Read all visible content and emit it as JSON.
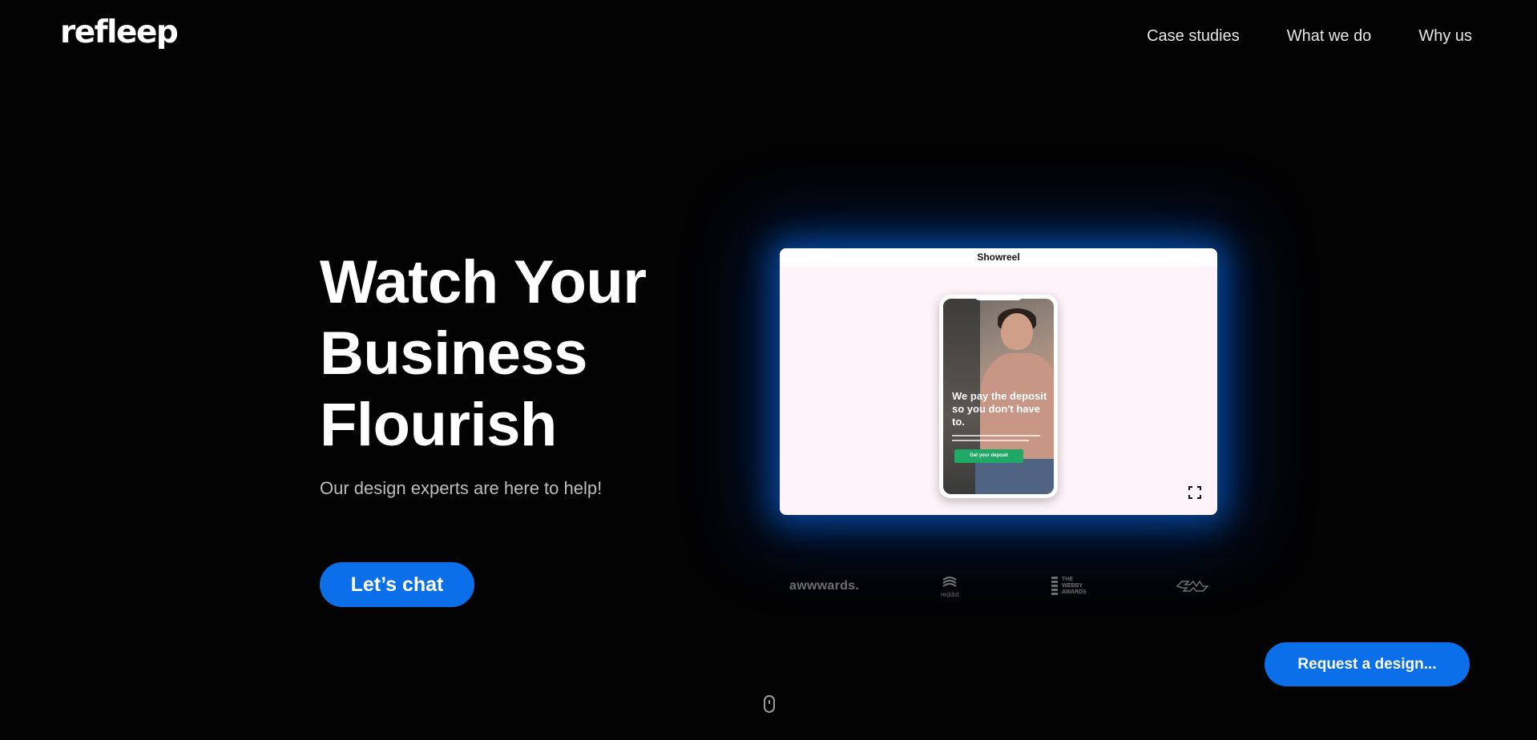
{
  "header": {
    "logo": "refleep",
    "nav": [
      {
        "label": "Case studies"
      },
      {
        "label": "What we do"
      },
      {
        "label": "Why us"
      }
    ]
  },
  "hero": {
    "title_lines": [
      "Watch Your",
      "Business",
      "Flourish"
    ],
    "subtitle": "Our design experts are here to help!",
    "cta_label": "Let’s chat"
  },
  "showreel": {
    "title": "Showreel",
    "phone_headline": "We pay the deposit so you don't have to.",
    "phone_cta": "Get your deposit",
    "fullscreen_icon": "fullscreen-icon"
  },
  "awards": {
    "awwwards": "awwwards.",
    "reddot": "reddot",
    "webby_line1": "THE",
    "webby_line2": "WEBBY",
    "webby_line3": "AWARDS",
    "fwa_icon": "fwa-logo-icon"
  },
  "request_button": "Request a design...",
  "scroll_icon": "mouse-scroll-icon",
  "colors": {
    "background": "#030304",
    "accent": "#0a6fe8",
    "showreel_bg": "#fdf3f8",
    "glow": "#0a6eeb"
  }
}
